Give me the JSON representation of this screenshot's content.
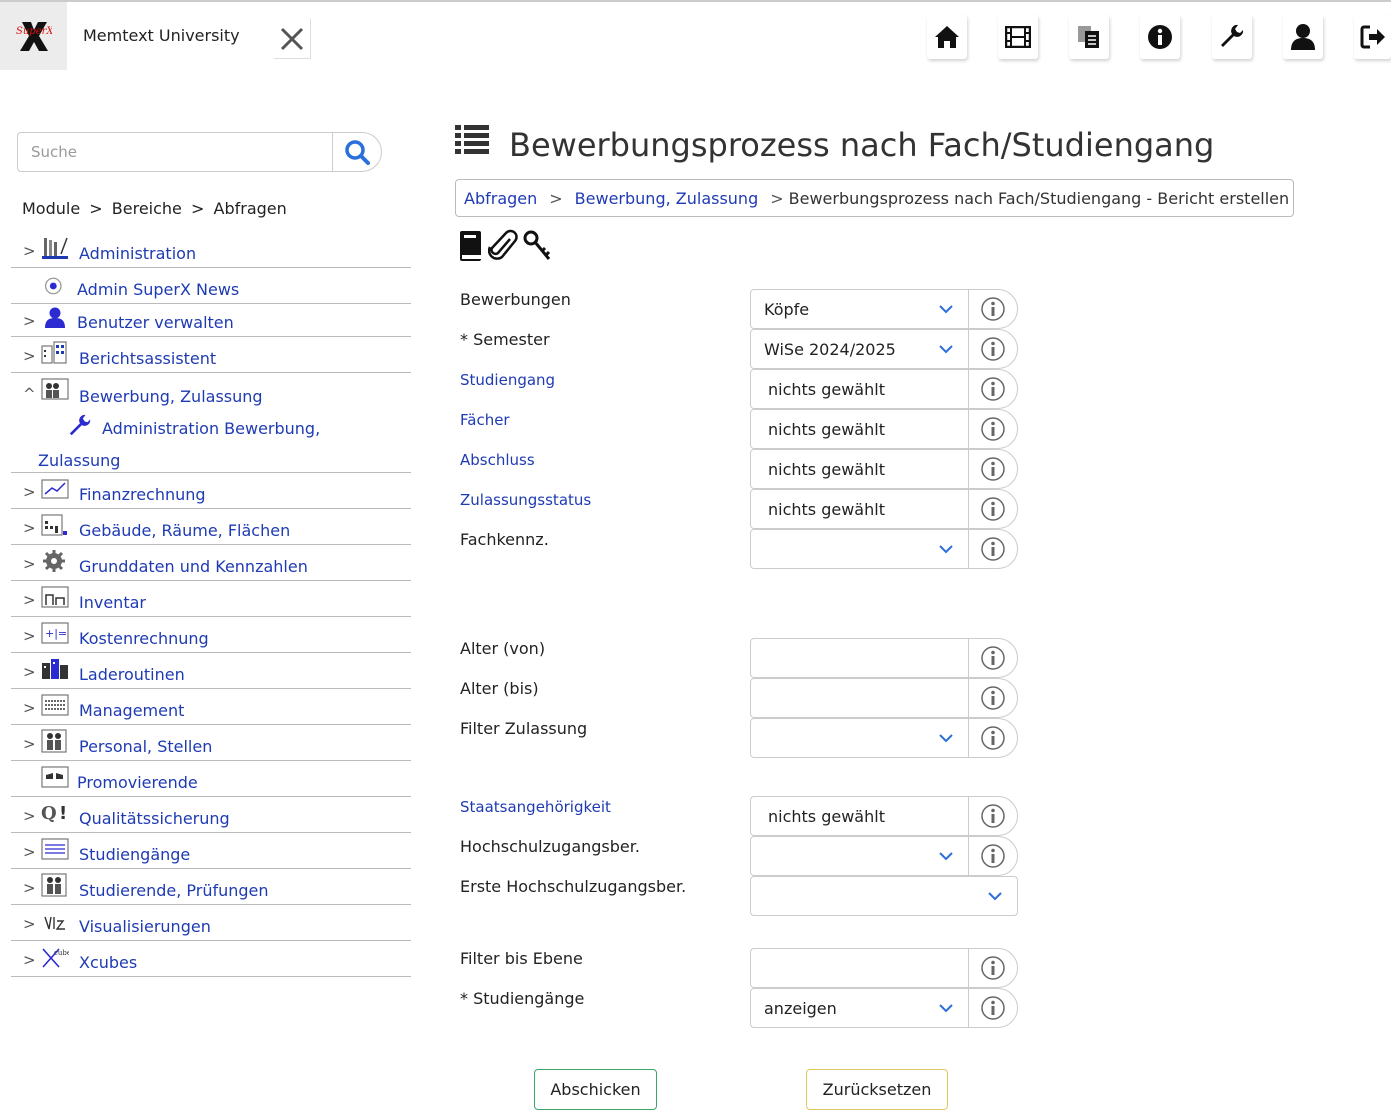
{
  "header": {
    "logo_text": "SuperX",
    "university": "Memtext University",
    "nav_icons": [
      "home-icon",
      "film-icon",
      "copy-icon",
      "info-icon",
      "wrench-icon",
      "user-icon",
      "logout-icon"
    ]
  },
  "sidebar": {
    "search_placeholder": "Suche",
    "breadcrumb": [
      "Module",
      ">",
      "Bereiche",
      ">",
      "Abfragen"
    ],
    "items": [
      {
        "toggle": ">",
        "label": "Administration",
        "icon": "admin-icon"
      },
      {
        "toggle": "",
        "label": "Admin SuperX News",
        "icon": "news-icon"
      },
      {
        "toggle": ">",
        "label": "Benutzer verwalten",
        "icon": "user-icon"
      },
      {
        "toggle": ">",
        "label": "Berichtsassistent",
        "icon": "report-icon"
      },
      {
        "toggle": "^",
        "label": "Bewerbung, Zulassung",
        "icon": "application-icon"
      },
      {
        "toggle": "",
        "label": "Administration Bewerbung,",
        "label2": "Zulassung",
        "icon": "wrench-icon"
      },
      {
        "toggle": ">",
        "label": "Finanzrechnung",
        "icon": "finance-icon"
      },
      {
        "toggle": ">",
        "label": "Gebäude, Räume, Flächen",
        "icon": "building-icon"
      },
      {
        "toggle": ">",
        "label": "Grunddaten und Kennzahlen",
        "icon": "gear-icon"
      },
      {
        "toggle": ">",
        "label": "Inventar",
        "icon": "inventory-icon"
      },
      {
        "toggle": ">",
        "label": "Kostenrechnung",
        "icon": "calculator-icon"
      },
      {
        "toggle": ">",
        "label": "Laderoutinen",
        "icon": "loader-icon"
      },
      {
        "toggle": ">",
        "label": "Management",
        "icon": "management-icon"
      },
      {
        "toggle": ">",
        "label": "Personal, Stellen",
        "icon": "staff-icon"
      },
      {
        "toggle": "",
        "label": "Promovierende",
        "icon": "doctorate-icon"
      },
      {
        "toggle": ">",
        "label": "Qualitätssicherung",
        "icon": "quality-icon"
      },
      {
        "toggle": ">",
        "label": "Studiengänge",
        "icon": "study-icon"
      },
      {
        "toggle": ">",
        "label": "Studierende, Prüfungen",
        "icon": "students-icon"
      },
      {
        "toggle": ">",
        "label": "Visualisierungen",
        "icon": "visual-icon"
      },
      {
        "toggle": ">",
        "label": "Xcubes",
        "icon": "xcube-icon"
      }
    ]
  },
  "main": {
    "title": "Bewerbungsprozess nach Fach/Studiengang",
    "breadcrumb": {
      "link1": "Abfragen",
      "sep": ">",
      "link2": "Bewerbung, Zulassung",
      "current": "Bewerbungsprozess nach Fach/Studiengang - Bericht erstellen"
    },
    "fields": {
      "bewerbungen": {
        "label": "Bewerbungen",
        "value": "Köpfe"
      },
      "semester": {
        "label": "* Semester",
        "value": "WiSe 2024/2025"
      },
      "studiengang": {
        "label": "Studiengang",
        "value": "nichts gewählt"
      },
      "faecher": {
        "label": "Fächer",
        "value": "nichts gewählt"
      },
      "abschluss": {
        "label": "Abschluss",
        "value": "nichts gewählt"
      },
      "zulassungsstatus": {
        "label": "Zulassungsstatus",
        "value": "nichts gewählt"
      },
      "fachkennz": {
        "label": "Fachkennz.",
        "value": ""
      },
      "alter_von": {
        "label": "Alter (von)",
        "value": ""
      },
      "alter_bis": {
        "label": "Alter (bis)",
        "value": ""
      },
      "filter_zulassung": {
        "label": "Filter Zulassung",
        "value": ""
      },
      "staatsangehoerigkeit": {
        "label": "Staatsangehörigkeit",
        "value": "nichts gewählt"
      },
      "hzb": {
        "label": "Hochschulzugangsber.",
        "value": ""
      },
      "erste_hzb": {
        "label": "Erste Hochschulzugangsber.",
        "value": ""
      },
      "filter_ebene": {
        "label": "Filter bis Ebene",
        "value": ""
      },
      "studiengaenge": {
        "label": "* Studiengänge",
        "value": "anzeigen"
      }
    },
    "buttons": {
      "submit": "Abschicken",
      "reset": "Zurücksetzen"
    }
  },
  "colors": {
    "link": "#1f3bb3",
    "accent_blue": "#2a6fdb",
    "submit_border": "#3aa66a",
    "reset_border": "#e0c860"
  }
}
